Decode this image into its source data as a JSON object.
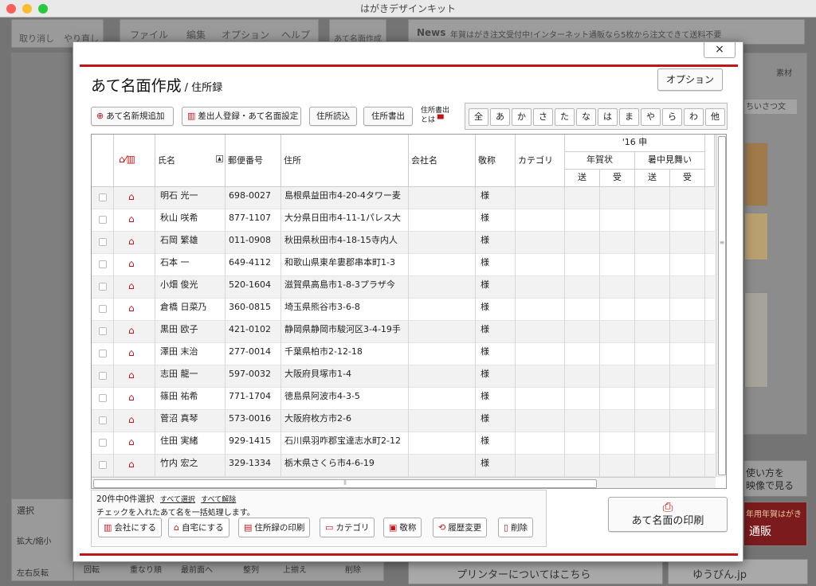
{
  "window": {
    "title": "はがきデザインキット"
  },
  "bg": {
    "undo": "取り消し",
    "redo": "やり直し",
    "menu": [
      "ファイル",
      "編集",
      "オプション",
      "ヘルプ"
    ],
    "address_tab": "あて名面作成",
    "news_label": "News",
    "news_text": "年賀はがき注文受付中!インターネット通販なら5枚から注文できて送料不要",
    "material": "素材",
    "greeting": "ちいさつ文",
    "video_line1": "使い方を",
    "video_line2": "映像で見る",
    "promo1": "年用年賀はがき",
    "promo2": "通販",
    "select_tab": "選択",
    "zoom_label": "拡大/縮小",
    "lr_flip": "左右反転",
    "rotate": "回転",
    "stack": "重なり順",
    "front": "最前面へ",
    "align": "整列",
    "align_top": "上揃え",
    "delete": "削除",
    "printer_info": "プリンターについてはこちら",
    "yubin": "ゆうびん.jp"
  },
  "dialog": {
    "title": "あて名面作成",
    "subtitle": "/ 住所録",
    "options": "オプション",
    "close": "×",
    "toolbar": {
      "add_new": "あて名新規追加",
      "sender": "差出人登録・あて名面設定",
      "import": "住所読込",
      "export": "住所書出",
      "export_help_1": "住所書出",
      "export_help_2": "とは"
    },
    "kana": [
      "全",
      "あ",
      "か",
      "さ",
      "た",
      "な",
      "は",
      "ま",
      "や",
      "ら",
      "わ",
      "他"
    ],
    "columns": {
      "name": "氏名",
      "zip": "郵便番号",
      "address": "住所",
      "company": "会社名",
      "honorific": "敬称",
      "category": "カテゴリ",
      "year": "'16 申",
      "nenga": "年賀状",
      "shochu": "暑中見舞い",
      "send": "送",
      "receive": "受"
    },
    "rows": [
      {
        "name": "明石 光一",
        "zip": "698-0027",
        "address": "島根県益田市4-20-4タワー麦",
        "honorific": "様"
      },
      {
        "name": "秋山 咲希",
        "zip": "877-1107",
        "address": "大分県日田市4-11-1パレス大",
        "honorific": "様"
      },
      {
        "name": "石岡 繁雄",
        "zip": "011-0908",
        "address": "秋田県秋田市4-18-15寺内人",
        "honorific": "様"
      },
      {
        "name": "石本 一",
        "zip": "649-4112",
        "address": "和歌山県東牟婁郡串本町1-3",
        "honorific": "様"
      },
      {
        "name": "小畑 俊光",
        "zip": "520-1604",
        "address": "滋賀県高島市1-8-3プラザ今",
        "honorific": "様"
      },
      {
        "name": "倉橋 日菜乃",
        "zip": "360-0815",
        "address": "埼玉県熊谷市3-6-8",
        "honorific": "様"
      },
      {
        "name": "黒田 欧子",
        "zip": "421-0102",
        "address": "静岡県静岡市駿河区3-4-19手",
        "honorific": "様"
      },
      {
        "name": "澤田 末治",
        "zip": "277-0014",
        "address": "千葉県柏市2-12-18",
        "honorific": "様"
      },
      {
        "name": "志田 龍一",
        "zip": "597-0032",
        "address": "大阪府貝塚市1-4",
        "honorific": "様"
      },
      {
        "name": "篠田 祐希",
        "zip": "771-1704",
        "address": "徳島県阿波市4-3-5",
        "honorific": "様"
      },
      {
        "name": "菅沼 真琴",
        "zip": "573-0016",
        "address": "大阪府枚方市2-6",
        "honorific": "様"
      },
      {
        "name": "住田 実緒",
        "zip": "929-1415",
        "address": "石川県羽咋郡宝達志水町2-12",
        "honorific": "様"
      },
      {
        "name": "竹内 宏之",
        "zip": "329-1334",
        "address": "栃木県さくら市4-6-19",
        "honorific": "様"
      }
    ],
    "status": "20件中0件選択",
    "select_all": "すべて選択",
    "clear_all": "すべて解除",
    "bulk_note": "チェックを入れたあて名を一括処理します。",
    "bulk": {
      "company": "会社にする",
      "home": "自宅にする",
      "print_list": "住所録の印刷",
      "category": "カテゴリ",
      "honorific": "敬称",
      "history": "履歴変更",
      "delete": "削除"
    },
    "print": "あて名面の印刷"
  }
}
